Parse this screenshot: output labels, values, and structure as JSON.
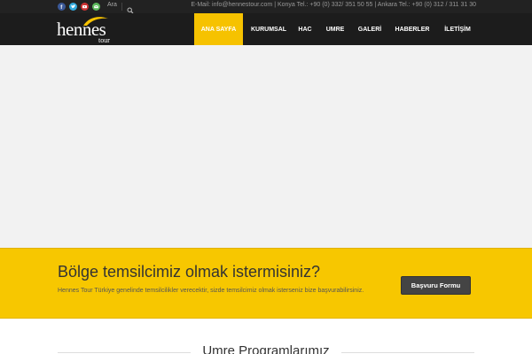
{
  "topbar": {
    "social": [
      {
        "name": "facebook-icon",
        "color": "#3b5998"
      },
      {
        "name": "twitter-icon",
        "color": "#33aadd"
      },
      {
        "name": "youtube-icon",
        "color": "#cc3333"
      },
      {
        "name": "email-icon",
        "color": "#5cb85c"
      }
    ],
    "search_label": "Ara",
    "contact": "E-Mail: info@hennestour.com | Konya Tel.: +90 (0) 332/ 351 50 55 | Ankara Tel.: +90 (0) 312 / 311 31 30"
  },
  "brand": {
    "name": "hennes",
    "sub": "tour",
    "accent": "#f6c200"
  },
  "nav": {
    "items": [
      "ANA SAYFA",
      "KURUMSAL",
      "HAC",
      "UMRE",
      "GALERİ",
      "HABERLER",
      "İLETİŞİM"
    ],
    "active": "ANA SAYFA"
  },
  "cta": {
    "title": "Bölge temsilcimiz olmak istermisiniz?",
    "text": "Hennes Tour Türkiye genelinde temsilcilikler verecektir, sizde temsilcimiz olmak isterseniz bize başvurabilirsiniz.",
    "button": "Başvuru Formu",
    "background": "#f7c700"
  },
  "section": {
    "title": "Umre Programlarımız"
  }
}
